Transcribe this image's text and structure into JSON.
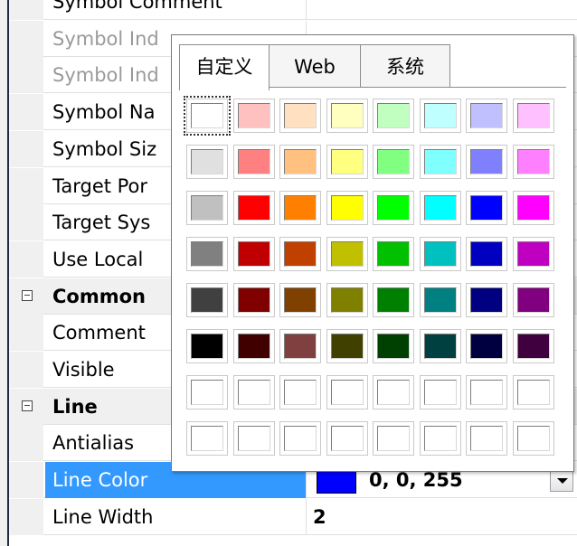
{
  "rows": [
    {
      "label": "Symbol Comment",
      "type": "prop"
    },
    {
      "label": "Symbol Ind",
      "type": "prop-disabled"
    },
    {
      "label": "Symbol Ind",
      "type": "prop-disabled"
    },
    {
      "label": "Symbol Na",
      "type": "prop"
    },
    {
      "label": "Symbol Siz",
      "type": "prop"
    },
    {
      "label": "Target Por",
      "type": "prop"
    },
    {
      "label": "Target Sys",
      "type": "prop"
    },
    {
      "label": "Use Local",
      "type": "prop"
    },
    {
      "label": "Common",
      "type": "category"
    },
    {
      "label": "Comment",
      "type": "prop"
    },
    {
      "label": "Visible",
      "type": "prop"
    },
    {
      "label": "Line",
      "type": "category"
    },
    {
      "label": "Antialias",
      "type": "prop"
    },
    {
      "label": "Line Color",
      "type": "selected",
      "value": "0, 0, 255",
      "swatch": "#0000ff"
    },
    {
      "label": "Line Width",
      "type": "prop",
      "value": "2"
    }
  ],
  "popup": {
    "tabs": [
      "自定义",
      "Web",
      "系统"
    ],
    "active_tab": 0,
    "palette": [
      [
        "#ffffff",
        "#ffc0c0",
        "#ffe0c0",
        "#ffffc0",
        "#c0ffc0",
        "#c0ffff",
        "#c0c0ff",
        "#ffc0ff"
      ],
      [
        "#e0e0e0",
        "#ff8080",
        "#ffc080",
        "#ffff80",
        "#80ff80",
        "#80ffff",
        "#8080ff",
        "#ff80ff"
      ],
      [
        "#c0c0c0",
        "#ff0000",
        "#ff8000",
        "#ffff00",
        "#00ff00",
        "#00ffff",
        "#0000ff",
        "#ff00ff"
      ],
      [
        "#808080",
        "#c00000",
        "#c04000",
        "#c0c000",
        "#00c000",
        "#00c0c0",
        "#0000c0",
        "#c000c0"
      ],
      [
        "#404040",
        "#800000",
        "#804000",
        "#808000",
        "#008000",
        "#008080",
        "#000080",
        "#800080"
      ],
      [
        "#000000",
        "#400000",
        "#804040",
        "#404000",
        "#004000",
        "#004040",
        "#000040",
        "#400040"
      ],
      [
        "#ffffff",
        "#ffffff",
        "#ffffff",
        "#ffffff",
        "#ffffff",
        "#ffffff",
        "#ffffff",
        "#ffffff"
      ],
      [
        "#ffffff",
        "#ffffff",
        "#ffffff",
        "#ffffff",
        "#ffffff",
        "#ffffff",
        "#ffffff",
        "#ffffff"
      ]
    ],
    "selected_cell": [
      0,
      0
    ]
  },
  "colors": {
    "selection": "#3399ff",
    "category_bg": "#f0f0f0",
    "disabled_text": "#9a9a9a"
  }
}
